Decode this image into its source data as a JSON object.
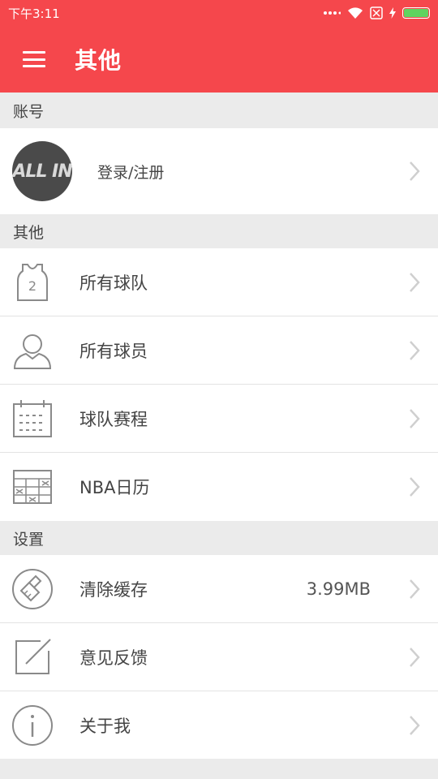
{
  "status_bar": {
    "time": "下午3:11"
  },
  "app_bar": {
    "title": "其他",
    "menu_icon": "hamburger-menu-icon"
  },
  "sections": {
    "account": {
      "header": "账号",
      "login_label": "登录/注册",
      "avatar_text": "ALL IN"
    },
    "other": {
      "header": "其他",
      "items": [
        {
          "label": "所有球队",
          "icon": "jersey-icon"
        },
        {
          "label": "所有球员",
          "icon": "person-icon"
        },
        {
          "label": "球队赛程",
          "icon": "calendar-icon"
        },
        {
          "label": "NBA日历",
          "icon": "calendar-grid-icon"
        }
      ]
    },
    "settings": {
      "header": "设置",
      "items": [
        {
          "label": "清除缓存",
          "value": "3.99MB",
          "icon": "broom-icon"
        },
        {
          "label": "意见反馈",
          "icon": "edit-icon"
        },
        {
          "label": "关于我",
          "icon": "info-icon"
        }
      ]
    }
  },
  "colors": {
    "accent": "#f5474c",
    "icon_gray": "#8a8a8a",
    "chevron_gray": "#cfcfcf"
  }
}
